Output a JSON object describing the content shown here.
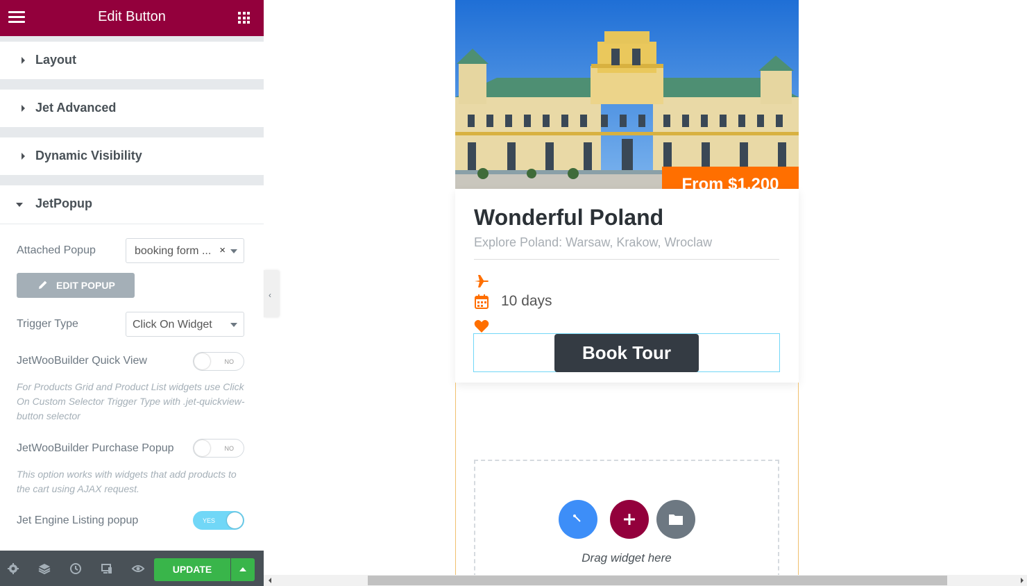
{
  "panel": {
    "title": "Edit Button",
    "sections": {
      "layout": "Layout",
      "jet_advanced": "Jet Advanced",
      "dynamic_visibility": "Dynamic Visibility",
      "jetpopup": "JetPopup"
    },
    "attached_popup": {
      "label": "Attached Popup",
      "value": "booking form ...",
      "clear": "×"
    },
    "edit_popup_label": "EDIT POPUP",
    "trigger_type": {
      "label": "Trigger Type",
      "value": "Click On Widget"
    },
    "quick_view": {
      "label": "JetWooBuilder Quick View",
      "state": "NO"
    },
    "quick_view_help": "For Products Grid and Product List widgets use Click On Custom Selector Trigger Type with .jet-quickview-button selector",
    "purchase_popup": {
      "label": "JetWooBuilder Purchase Popup",
      "state": "NO"
    },
    "purchase_popup_help": "This option works with widgets that add products to the cart using AJAX request.",
    "listing_popup": {
      "label": "Jet Engine Listing popup",
      "state": "YES"
    },
    "update_label": "UPDATE",
    "colors": {
      "header": "#93003c",
      "update": "#39b54a",
      "toggle_on": "#71d7f7"
    }
  },
  "preview": {
    "price": "From $1,200",
    "title": "Wonderful Poland",
    "subtitle": "Explore Poland: Warsaw, Krakow, Wroclaw",
    "duration": "10 days",
    "book_button": "Book Tour",
    "drag_text": "Drag widget here",
    "icons": [
      "plane-icon",
      "calendar-icon",
      "heart-icon"
    ],
    "colors": {
      "accent": "#ff6f00",
      "button": "#343b43"
    }
  }
}
